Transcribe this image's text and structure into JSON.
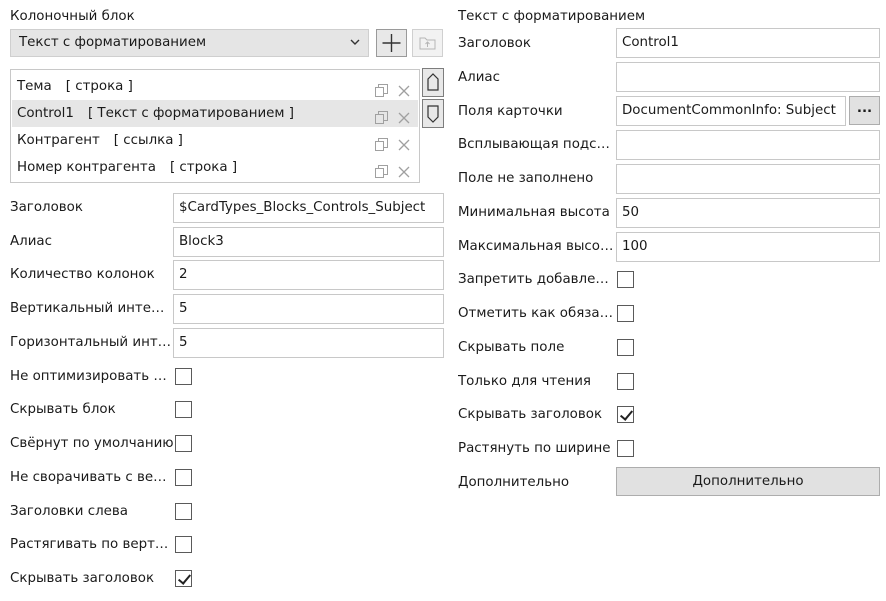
{
  "left": {
    "section_title": "Колоночный блок",
    "block_type_combo": "Текст с форматированием",
    "list_items": [
      {
        "name": "Тема",
        "type": "[ строка ]"
      },
      {
        "name": "Control1",
        "type": "[ Текст с форматированием ]"
      },
      {
        "name": "Контрагент",
        "type": "[ ссылка ]"
      },
      {
        "name": "Номер контрагента",
        "type": "[ строка ]"
      }
    ],
    "fields": [
      {
        "label": "Заголовок",
        "value": "$CardTypes_Blocks_Controls_Subject"
      },
      {
        "label": "Алиас",
        "value": "Block3"
      },
      {
        "label": "Количество колонок",
        "value": "2"
      },
      {
        "label": "Вертикальный интервал",
        "value": "5"
      },
      {
        "label": "Горизонтальный интервал",
        "value": "5"
      }
    ],
    "checkboxes": [
      {
        "label": "Не оптимизировать блок",
        "checked": false
      },
      {
        "label": "Скрывать блок",
        "checked": false
      },
      {
        "label": "Свёрнут по умолчанию",
        "checked": false
      },
      {
        "label": "Не сворачивать с вертикальной прокруткой",
        "checked": false
      },
      {
        "label": "Заголовки слева",
        "checked": false
      },
      {
        "label": "Растягивать по вертикали",
        "checked": false
      },
      {
        "label": "Скрывать заголовок",
        "checked": true
      }
    ]
  },
  "right": {
    "section_title": "Текст с форматированием",
    "fields": [
      {
        "label": "Заголовок",
        "value": "Control1"
      },
      {
        "label": "Алиас",
        "value": ""
      },
      {
        "label": "Поля карточки",
        "value": "DocumentCommonInfo: Subject"
      },
      {
        "label": "Всплывающая подсказка",
        "value": ""
      },
      {
        "label": "Поле не заполнено",
        "value": ""
      },
      {
        "label": "Минимальная высота",
        "value": "50"
      },
      {
        "label": "Максимальная высота",
        "value": "100"
      }
    ],
    "ellipsis_button": "...",
    "checkboxes": [
      {
        "label": "Запретить добавление",
        "checked": false
      },
      {
        "label": "Отметить как обязательное",
        "checked": false
      },
      {
        "label": "Скрывать поле",
        "checked": false
      },
      {
        "label": "Только для чтения",
        "checked": false
      },
      {
        "label": "Скрывать заголовок",
        "checked": true
      },
      {
        "label": "Растянуть по ширине",
        "checked": false
      }
    ],
    "advanced_label": "Дополнительно",
    "advanced_button": "Дополнительно"
  }
}
